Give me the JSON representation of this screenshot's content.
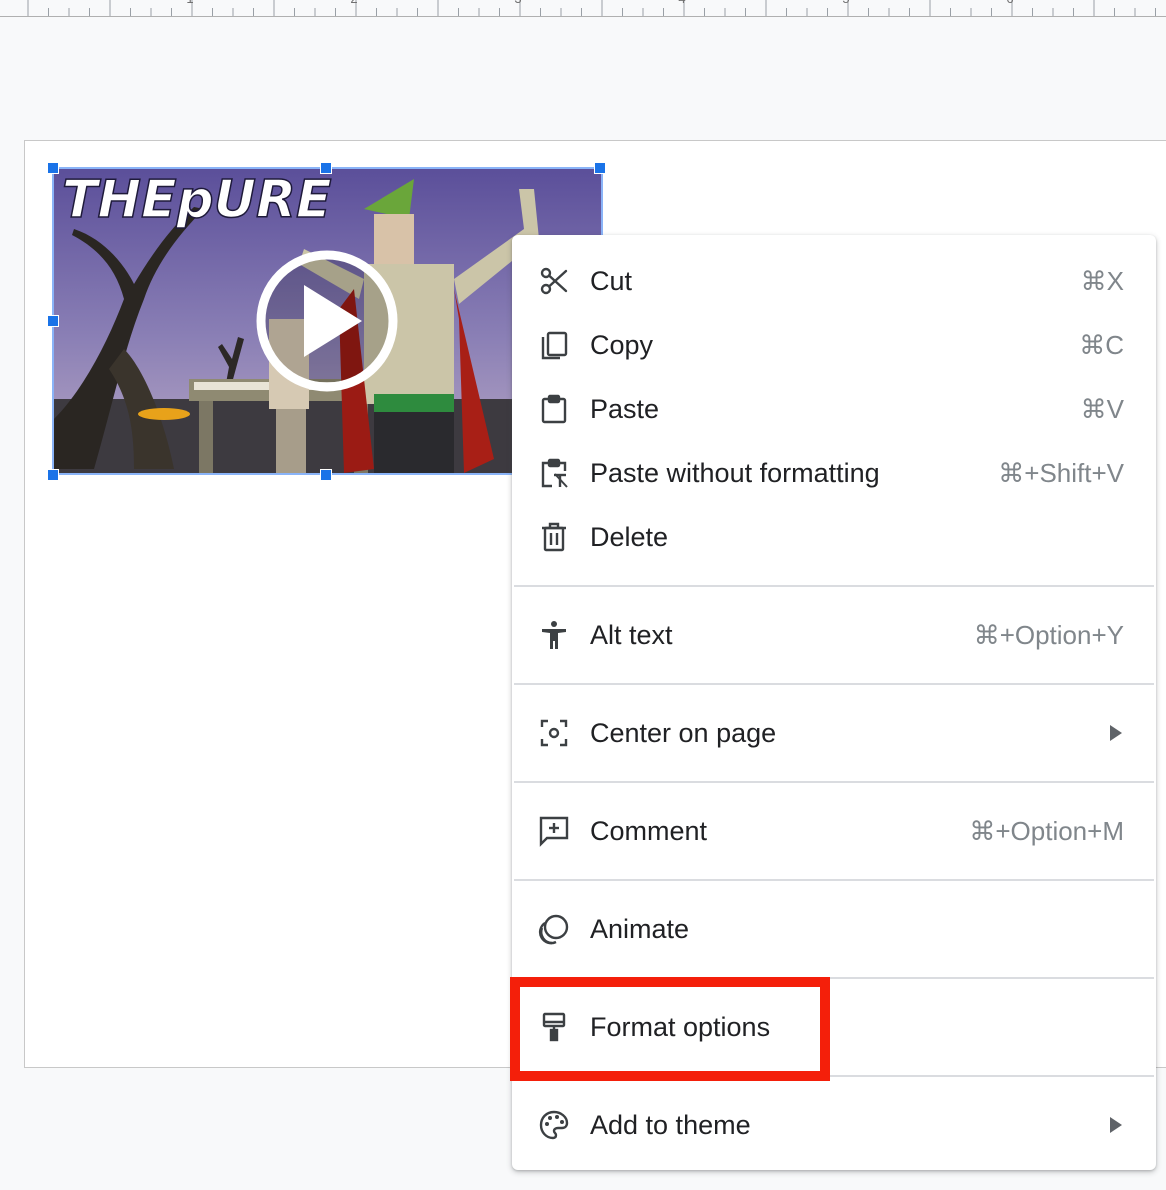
{
  "ruler": {
    "numbers": [
      "1",
      "2",
      "3",
      "4",
      "5",
      "6"
    ]
  },
  "video": {
    "title_text": "THEpURE",
    "play_icon": "play-circle-icon"
  },
  "context_menu": {
    "items": [
      {
        "id": "cut",
        "icon": "scissors-icon",
        "label": "Cut",
        "shortcut": "⌘X"
      },
      {
        "id": "copy",
        "icon": "copy-icon",
        "label": "Copy",
        "shortcut": "⌘C"
      },
      {
        "id": "paste",
        "icon": "clipboard-icon",
        "label": "Paste",
        "shortcut": "⌘V"
      },
      {
        "id": "paste-plain",
        "icon": "paste-plain-icon",
        "label": "Paste without formatting",
        "shortcut": "⌘+Shift+V"
      },
      {
        "id": "delete",
        "icon": "trash-icon",
        "label": "Delete",
        "shortcut": ""
      },
      {
        "id": "alt-text",
        "icon": "accessibility-icon",
        "label": "Alt text",
        "shortcut": "⌘+Option+Y"
      },
      {
        "id": "center",
        "icon": "center-focus-icon",
        "label": "Center on page",
        "shortcut": "",
        "submenu": true
      },
      {
        "id": "comment",
        "icon": "add-comment-icon",
        "label": "Comment",
        "shortcut": "⌘+Option+M"
      },
      {
        "id": "animate",
        "icon": "animate-icon",
        "label": "Animate",
        "shortcut": ""
      },
      {
        "id": "format",
        "icon": "paint-roller-icon",
        "label": "Format options",
        "shortcut": ""
      },
      {
        "id": "theme",
        "icon": "palette-icon",
        "label": "Add to theme",
        "shortcut": "",
        "submenu": true
      }
    ]
  },
  "colors": {
    "selection": "#1a73e8",
    "highlight": "#f41f0a",
    "shortcut_text": "#80868b"
  }
}
